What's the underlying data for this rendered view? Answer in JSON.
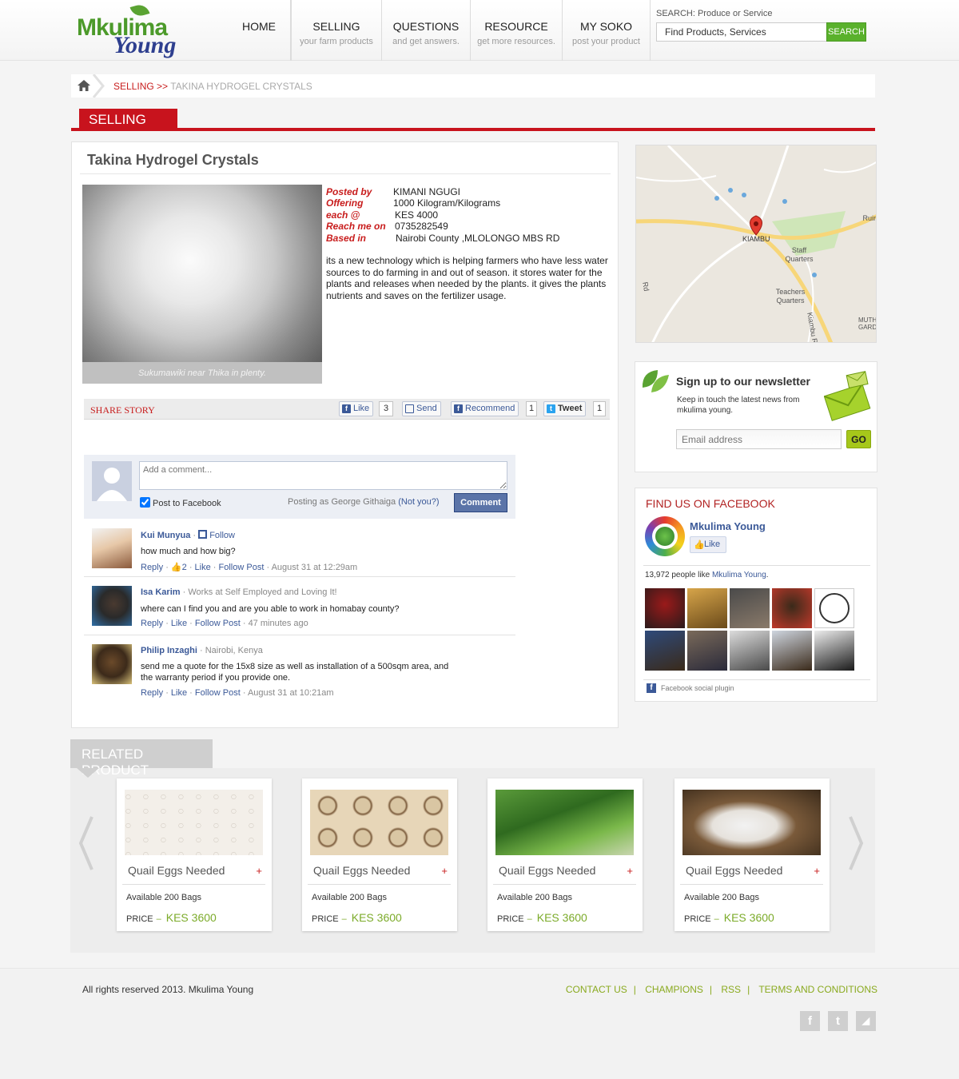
{
  "header": {
    "logo_top": "Mkulima",
    "logo_bottom": "Young",
    "nav": [
      {
        "title": "HOME",
        "subtitle": ""
      },
      {
        "title": "SELLING",
        "subtitle": "your farm products"
      },
      {
        "title": "QUESTIONS",
        "subtitle": "and get answers."
      },
      {
        "title": "RESOURCE",
        "subtitle": "get more resources."
      },
      {
        "title": "MY SOKO",
        "subtitle": "post your product"
      }
    ],
    "search": {
      "label": "SEARCH: Produce or Service",
      "value": "Find Products, Services",
      "button": "SEARCH"
    }
  },
  "breadcrumb": {
    "section": "SELLING",
    "separator": ">>",
    "current": "TAKINA HYDROGEL CRYSTALS"
  },
  "section_tab": "SELLING",
  "product": {
    "title": "Takina Hydrogel Crystals",
    "caption": "Sukumawiki near Thika in plenty.",
    "details": [
      {
        "label": "Posted by",
        "value": "KIMANI NGUGI"
      },
      {
        "label": "Offering",
        "value": "1000 Kilogram/Kilograms"
      },
      {
        "label": "each @",
        "value": "KES 4000"
      },
      {
        "label": "Reach me on",
        "value": "0735282549"
      },
      {
        "label": "Based in",
        "value": "Nairobi County ,MLOLONGO MBS RD"
      }
    ],
    "description": "its a new technology which is helping farmers who have less water sources to do farming in and out of season. it stores water for the plants and releases when needed by the plants. it gives the plants nutrients and saves on the fertilizer usage."
  },
  "share": {
    "title": "SHARE STORY",
    "like": "Like",
    "like_count": "3",
    "send": "Send",
    "recommend": "Recommend",
    "recommend_count": "1",
    "tweet": "Tweet",
    "tweet_count": "1"
  },
  "comment_box": {
    "placeholder": "Add a comment...",
    "post_to_facebook": "Post to Facebook",
    "posting_as_prefix": "Posting as",
    "posting_as_name": "George Githaiga",
    "not_you": "(Not you?)",
    "button": "Comment"
  },
  "comments": [
    {
      "name": "Kui Munyua",
      "meta": "",
      "follow": "Follow",
      "text": "how much and how big?",
      "reply": "Reply",
      "likes": "2",
      "like": "Like",
      "follow_post": "Follow Post",
      "time": "August 31 at 12:29am"
    },
    {
      "name": "Isa Karim",
      "meta": "Works at Self Employed and Loving It!",
      "follow": "",
      "text": "where can I find you and are you able to work in homabay county?",
      "reply": "Reply",
      "likes": "",
      "like": "Like",
      "follow_post": "Follow Post",
      "time": "47 minutes ago"
    },
    {
      "name": "Philip Inzaghi",
      "meta": "Nairobi, Kenya",
      "follow": "",
      "text": "send me a quote for the 15x8 size as well as installation of a 500sqm area, and\nthe warranty period if you provide one.",
      "reply": "Reply",
      "likes": "",
      "like": "Like",
      "follow_post": "Follow Post",
      "time": "August 31 at 10:21am"
    }
  ],
  "map": {
    "labels": [
      "Ruiru",
      "KIAMBU",
      "Staff Quarters",
      "Teachers Quarters",
      "Kiambu R",
      "Rd",
      "MUTH GARD"
    ]
  },
  "newsletter": {
    "title": "Sign up to our newsletter",
    "text": "Keep in touch the latest news from mkulima young.",
    "placeholder": "Email address",
    "button": "GO"
  },
  "facebook": {
    "title": "FIND US ON FACEBOOK",
    "page_name": "Mkulima Young",
    "like": "Like",
    "count_text": "13,972 people like",
    "count_link": "Mkulima Young",
    "plugin": "Facebook social plugin"
  },
  "related": {
    "title": "RELATED PRODUCT",
    "items": [
      {
        "name": "Quail Eggs Needed",
        "available": "Available 200 Bags",
        "price_label": "PRICE",
        "price": "KES 3600"
      },
      {
        "name": "Quail Eggs Needed",
        "available": "Available 200 Bags",
        "price_label": "PRICE",
        "price": "KES 3600"
      },
      {
        "name": "Quail Eggs Needed",
        "available": "Available 200 Bags",
        "price_label": "PRICE",
        "price": "KES 3600"
      },
      {
        "name": "Quail Eggs Needed",
        "available": "Available 200 Bags",
        "price_label": "PRICE",
        "price": "KES 3600"
      }
    ]
  },
  "footer": {
    "copyright": "All rights reserved 2013. Mkulima Young",
    "links": [
      "CONTACT US",
      "CHAMPIONS",
      "RSS",
      "TERMS AND CONDITIONS"
    ],
    "link_separator": "|",
    "social": [
      {
        "icon": "facebook-icon",
        "glyph": "f"
      },
      {
        "icon": "twitter-icon",
        "glyph": "t"
      },
      {
        "icon": "rss-icon",
        "glyph": "◢"
      }
    ]
  },
  "colors": {
    "accent_red": "#c8131d",
    "accent_green": "#5ab12c",
    "facebook_blue": "#3b5998",
    "price_green": "#7cab2a"
  }
}
